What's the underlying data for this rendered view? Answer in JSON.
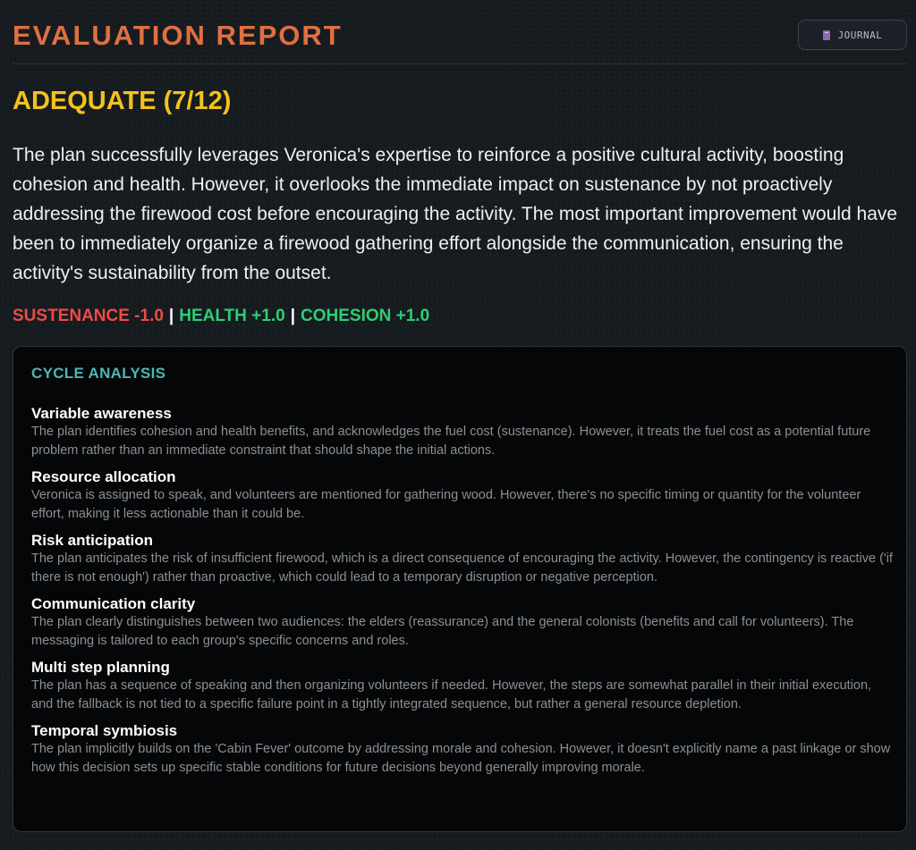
{
  "header": {
    "title": "EVALUATION REPORT",
    "journal_label": "JOURNAL",
    "journal_icon": "book-icon"
  },
  "rating": "ADEQUATE (7/12)",
  "summary": "The plan successfully leverages Veronica's expertise to reinforce a positive cultural activity, boosting cohesion and health. However, it overlooks the immediate impact on sustenance by not proactively addressing the firewood cost before encouraging the activity. The most important improvement would have been to immediately organize a firewood gathering effort alongside the communication, ensuring the activity's sustainability from the outset.",
  "deltas": [
    {
      "label": "SUSTENANCE -1.0",
      "color": "#ef4b45"
    },
    {
      "label": "HEALTH +1.0",
      "color": "#2fce74"
    },
    {
      "label": "COHESION +1.0",
      "color": "#2fce74"
    }
  ],
  "analysis": {
    "title": "CYCLE ANALYSIS",
    "items": [
      {
        "title": "Variable awareness",
        "text": "The plan identifies cohesion and health benefits, and acknowledges the fuel cost (sustenance). However, it treats the fuel cost as a potential future problem rather than an immediate constraint that should shape the initial actions."
      },
      {
        "title": "Resource allocation",
        "text": "Veronica is assigned to speak, and volunteers are mentioned for gathering wood. However, there's no specific timing or quantity for the volunteer effort, making it less actionable than it could be."
      },
      {
        "title": "Risk anticipation",
        "text": "The plan anticipates the risk of insufficient firewood, which is a direct consequence of encouraging the activity. However, the contingency is reactive ('if there is not enough') rather than proactive, which could lead to a temporary disruption or negative perception."
      },
      {
        "title": "Communication clarity",
        "text": "The plan clearly distinguishes between two audiences: the elders (reassurance) and the general colonists (benefits and call for volunteers). The messaging is tailored to each group's specific concerns and roles."
      },
      {
        "title": "Multi step planning",
        "text": "The plan has a sequence of speaking and then organizing volunteers if needed. However, the steps are somewhat parallel in their initial execution, and the fallback is not tied to a specific failure point in a tightly integrated sequence, but rather a general resource depletion."
      },
      {
        "title": "Temporal symbiosis",
        "text": "The plan implicitly builds on the 'Cabin Fever' outcome by addressing morale and cohesion. However, it doesn't explicitly name a past linkage or show how this decision sets up specific stable conditions for future decisions beyond generally improving morale."
      }
    ]
  }
}
